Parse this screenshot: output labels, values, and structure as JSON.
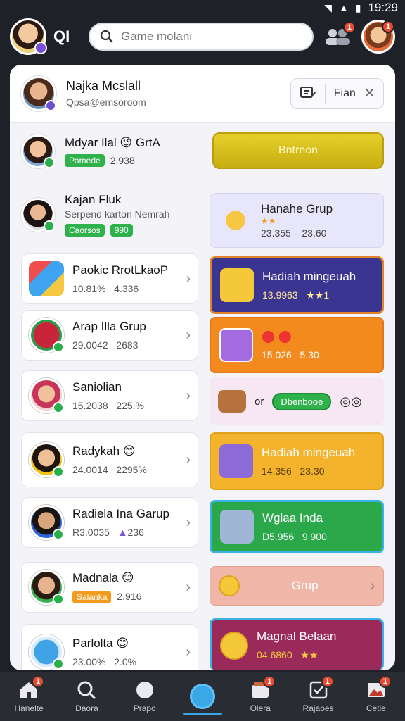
{
  "status": {
    "time": "19:29"
  },
  "top": {
    "qi_label": "QI",
    "search_placeholder": "Game molani",
    "group_badge": "1",
    "avatar_badge": "1"
  },
  "profile": {
    "name": "Najka Mcslall",
    "email": "Qpsa@emsoroom",
    "fian_label": "Fian"
  },
  "featured": [
    {
      "name": "Mdyar Ilal 😉 GrtA",
      "tag": "Pamede",
      "value": "2.938",
      "button": "Bntrnon"
    },
    {
      "name": "Kajan Fluk",
      "sub": "Serpend karton Nemrah",
      "tag": "Caorsos",
      "value": "990"
    }
  ],
  "hadiah_grup": {
    "title": "Hanahe Grup",
    "stars": "★★",
    "v1": "23.355",
    "v2": "23.60"
  },
  "left_list": [
    {
      "title": "Paokic RrotLkaoP",
      "m1": "10.81%",
      "m2": "4.336"
    },
    {
      "title": "Arap Illa Grup",
      "m1": "29.0042",
      "m2": "2683"
    },
    {
      "title": "Saniolian",
      "m1": "15.2038",
      "m2": "225.%"
    },
    {
      "title": "Radykah 😊",
      "m1": "24.0014",
      "m2": "2295%"
    },
    {
      "title": "Radiela Ina Garup",
      "m1": "R3.0035",
      "m2": "236"
    },
    {
      "title": "Madnala 😊",
      "tag": "Salanka",
      "m2": "2.916"
    },
    {
      "title": "Parlolta 😊",
      "m1": "23.00%",
      "m2": "2.0%"
    }
  ],
  "right_list": [
    {
      "title": "Hadiah mingeuah",
      "m1": "13.9963",
      "m2": "★★1"
    },
    {
      "title": "",
      "m1": "15.026",
      "m2": "5.30"
    },
    {
      "title": "or",
      "pill": "Dbenbooe"
    },
    {
      "title": "Hadiah mingeuah",
      "m1": "14.356",
      "m2": "23.30"
    },
    {
      "title": "Wglaa Inda",
      "m1": "D5.956",
      "m2": "9 900"
    },
    {
      "title": "Grup"
    },
    {
      "title": "Magnal Belaan",
      "m1": "04.6860",
      "m2": "★★"
    }
  ],
  "nav": [
    {
      "label": "Hanelte",
      "icon": "home-icon",
      "badge": "1"
    },
    {
      "label": "Daora",
      "icon": "search-icon"
    },
    {
      "label": "Prapo",
      "icon": "compass-icon"
    },
    {
      "label": "",
      "icon": "center-action-icon"
    },
    {
      "label": "Olera",
      "icon": "store-icon",
      "badge": "1"
    },
    {
      "label": "Rajaoes",
      "icon": "check-icon",
      "badge": "1"
    },
    {
      "label": "Cetle",
      "icon": "image-icon",
      "badge": "1"
    }
  ],
  "colors": {
    "background": "#1f2128",
    "yellow_button": "#d8bd1c",
    "purple_card": "#3a3590",
    "orange_card": "#f28a1e",
    "gold_card": "#f3b32c",
    "green_card": "#2aa84a",
    "peach_card": "#f0b7a8",
    "maroon_card": "#9a2a5a"
  }
}
